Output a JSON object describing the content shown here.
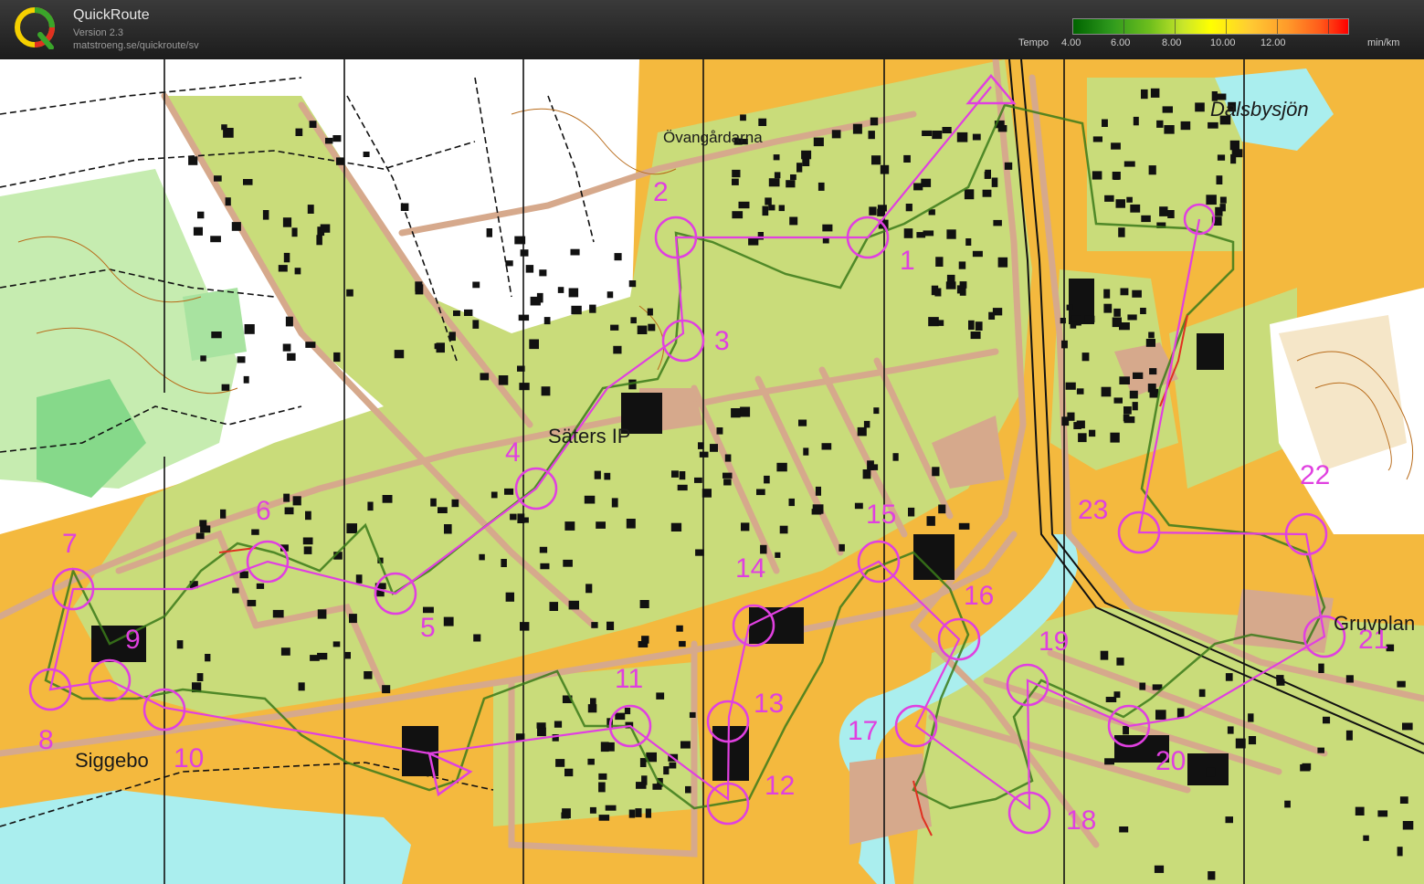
{
  "app": {
    "title": "QuickRoute",
    "version": "Version 2.3",
    "url": "matstroeng.se/quickroute/sv"
  },
  "tempo": {
    "label": "Tempo",
    "unit": "min/km",
    "values": [
      "4.00",
      "6.00",
      "8.00",
      "10.00",
      "12.00"
    ]
  },
  "map": {
    "place_names": {
      "dalsbysjon": "Dalsbysjön",
      "ovangardarna": "Övangårdarna",
      "saters_ip": "Säters IP",
      "siggebo": "Siggebo",
      "gruvplan": "Gruvplan"
    },
    "controls": [
      "1",
      "2",
      "3",
      "4",
      "5",
      "6",
      "7",
      "8",
      "9",
      "10",
      "11",
      "12",
      "13",
      "14",
      "15",
      "16",
      "17",
      "18",
      "19",
      "20",
      "21",
      "22",
      "23"
    ]
  },
  "colors": {
    "control": "#e040e0",
    "urban_green": "#c9dc7a",
    "open_land": "#f4b93e",
    "forest": "#ffffff",
    "water": "#aaeeee",
    "road": "#d6a98c",
    "building": "#111111"
  }
}
